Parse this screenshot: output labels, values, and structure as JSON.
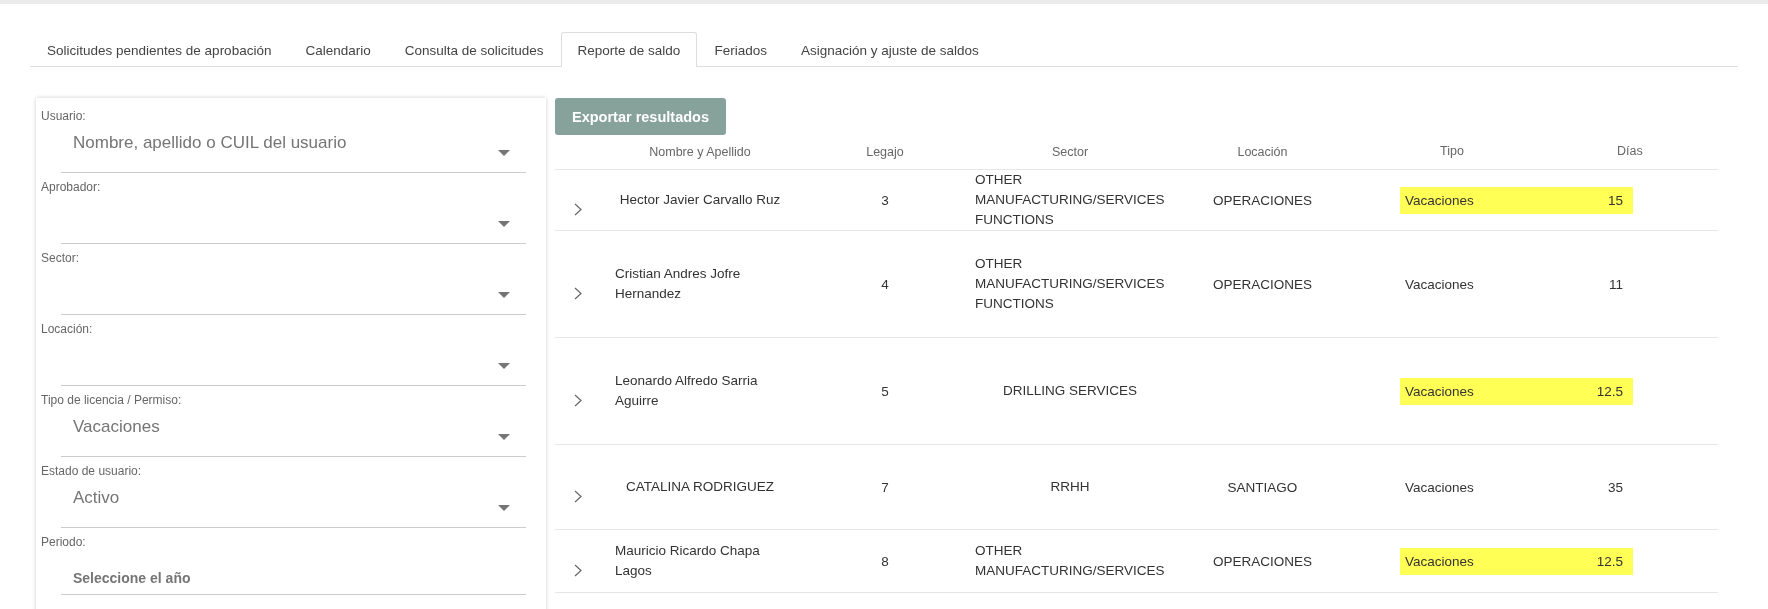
{
  "tabs": [
    {
      "label": "Solicitudes pendientes de aprobación",
      "selected": false
    },
    {
      "label": "Calendario",
      "selected": false
    },
    {
      "label": "Consulta de solicitudes",
      "selected": false
    },
    {
      "label": "Reporte de saldo",
      "selected": true
    },
    {
      "label": "Feriados",
      "selected": false
    },
    {
      "label": "Asignación y ajuste de saldos",
      "selected": false
    }
  ],
  "filters": [
    {
      "kind": "select",
      "label": "Usuario:",
      "placeholder": "Nombre, apellido o CUIL del usuario"
    },
    {
      "kind": "select",
      "label": "Aprobador:"
    },
    {
      "kind": "select",
      "label": "Sector:"
    },
    {
      "kind": "select",
      "label": "Locación:"
    },
    {
      "kind": "select",
      "label": "Tipo de licencia / Permiso:",
      "value": "Vacaciones"
    },
    {
      "kind": "select",
      "label": "Estado de usuario:",
      "value": "Activo"
    },
    {
      "kind": "year",
      "label": "Periodo:",
      "placeholder": "Seleccione el año"
    }
  ],
  "export_button": "Exportar resultados",
  "table": {
    "columns": [
      "Nombre y Apellido",
      "Legajo",
      "Sector",
      "Locación",
      "Tipo",
      "Días"
    ],
    "rows": [
      {
        "name": "Hector Javier Carvallo Ruz",
        "legajo": "3",
        "sector": "OTHER MANUFACTURING/SERVICES FUNCTIONS",
        "location": "OPERACIONES",
        "type": "Vacaciones",
        "days": "15",
        "highlighted": true
      },
      {
        "name": "Cristian Andres Jofre Hernandez",
        "legajo": "4",
        "sector": "OTHER MANUFACTURING/SERVICES FUNCTIONS",
        "location": "OPERACIONES",
        "type": "Vacaciones",
        "days": "11",
        "highlighted": false
      },
      {
        "name": "Leonardo Alfredo Sarria Aguirre",
        "legajo": "5",
        "sector": "DRILLING SERVICES",
        "type": "Vacaciones",
        "days": "12.5",
        "highlighted": true
      },
      {
        "name": "CATALINA RODRIGUEZ",
        "legajo": "7",
        "sector": "RRHH",
        "location": "SANTIAGO",
        "type": "Vacaciones",
        "days": "35",
        "highlighted": false
      },
      {
        "name": "Mauricio Ricardo Chapa Lagos",
        "legajo": "8",
        "sector": "OTHER MANUFACTURING/SERVICES",
        "location": "OPERACIONES",
        "type": "Vacaciones",
        "days": "12.5",
        "highlighted": true
      }
    ]
  }
}
